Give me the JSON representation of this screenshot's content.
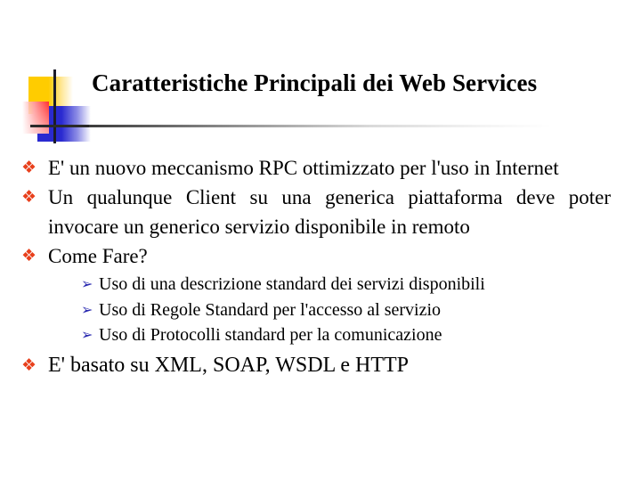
{
  "slide": {
    "title": "Caratteristiche Principali dei Web Services",
    "bullet_icon": "❖",
    "sub_bullet_icon": "➢",
    "colors": {
      "bullet": "#e8401c",
      "sub_bullet": "#2a2ab0",
      "logo_yellow": "#ffcc00",
      "logo_red": "#ff3030",
      "logo_blue": "#2a2ad0"
    },
    "bullets": [
      {
        "text": "E' un nuovo meccanismo RPC ottimizzato per l'uso in Internet"
      },
      {
        "text": "Un qualunque Client su una generica piattaforma deve poter invocare un generico servizio disponibile in remoto"
      },
      {
        "text": "Come Fare?",
        "subitems": [
          "Uso di una descrizione standard dei servizi disponibili",
          "Uso di Regole Standard per l'accesso al servizio",
          "Uso di Protocolli standard per la comunicazione"
        ]
      },
      {
        "text": "E' basato su XML, SOAP, WSDL e HTTP"
      }
    ]
  }
}
